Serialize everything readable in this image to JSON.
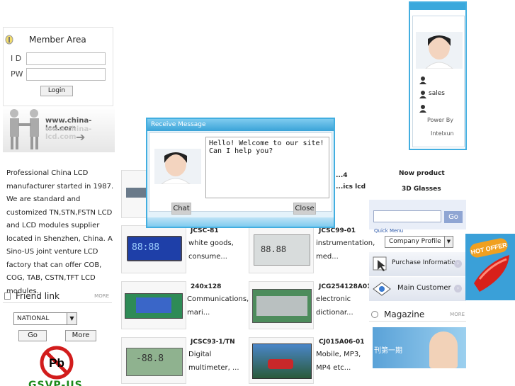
{
  "member": {
    "title": "Member Area",
    "id_label": "I D",
    "pw_label": "PW",
    "login_label": "Login"
  },
  "banner": {
    "url": "www.china-lcd.com",
    "url_reflection": "www.china-lcd.com"
  },
  "description": "Professional China LCD manufacturer started in 1987. We are standard and customized TN,STN,FSTN LCD and LCD modules supplier located in Shenzhen, China. A Sino-US joint venture LCD factory that can offer COB, COG, TAB, CSTN,TFT LCD modules.",
  "friend_link": {
    "title": "Friend link",
    "more": "MORE",
    "select_value": "NATIONAL",
    "go_label": "Go",
    "more_button": "More",
    "rohs_text": "GSVP-US",
    "no_pb_text": "Pb"
  },
  "products": [
    {
      "name": "...4",
      "desc": "...ics lcd"
    },
    {
      "name": "JCSC-81",
      "desc": "white goods, consume..."
    },
    {
      "name": "JCSC99-01",
      "desc": "instrumentation, med..."
    },
    {
      "name": "240x128",
      "desc": "Communications, mari..."
    },
    {
      "name": "JCG254128A01",
      "desc": "electronic dictionar..."
    },
    {
      "name": "JCSC93-1/TN",
      "desc": "Digital multimeter, ..."
    },
    {
      "name": "CJ015A06-01",
      "desc": "Mobile, MP3, MP4 etc..."
    }
  ],
  "right": {
    "new_product": "Now product",
    "glasses": "3D Glasses",
    "search_go": "Go",
    "quick_menu": "Quick Menu",
    "profile_select": "Company Profile",
    "purchase": "Purchase Information",
    "main_customer": "Main Customer",
    "magazine_title": "Magazine",
    "magazine_more": "MORE",
    "magazine_img_text": "刊第一期",
    "hot_offer": "HOT OFFER"
  },
  "chat_panel": {
    "sales_label": "sales",
    "power_by": "Power By",
    "brand": "Intelxun"
  },
  "dialog": {
    "title": "Receive Message",
    "message": "Hello! Welcome to our site!\nCan I help you?",
    "chat_label": "Chat",
    "close_label": "Close"
  },
  "colors": {
    "accent_blue": "#42aee0",
    "link_blue": "#2855a8"
  }
}
